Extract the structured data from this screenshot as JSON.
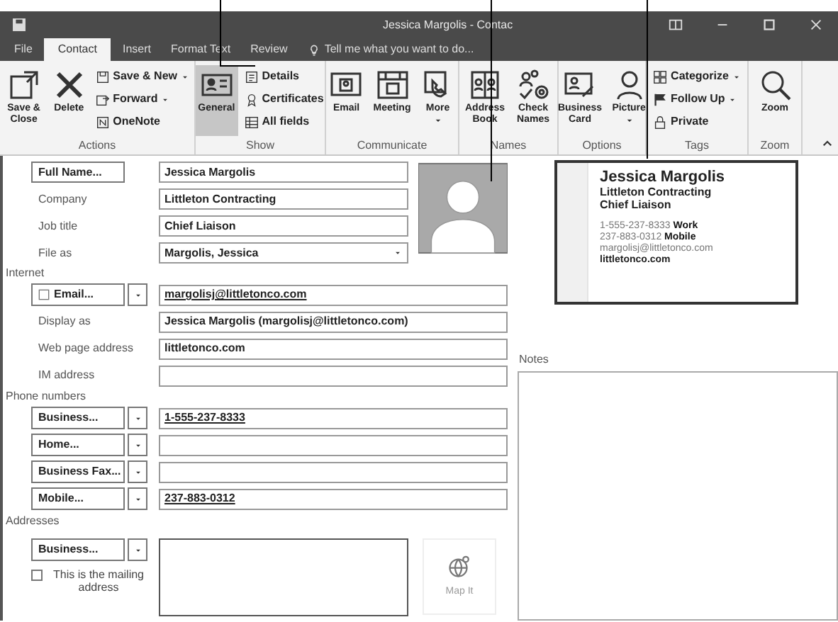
{
  "window": {
    "title": "Jessica Margolis - Contac"
  },
  "tabs": [
    {
      "label": "File",
      "selected": false
    },
    {
      "label": "Contact",
      "selected": true
    },
    {
      "label": "Insert",
      "selected": false
    },
    {
      "label": "Format Text",
      "selected": false
    },
    {
      "label": "Review",
      "selected": false
    }
  ],
  "tell_me": {
    "placeholder": "Tell me what you want to do..."
  },
  "ribbon_groups": [
    {
      "label": "Actions",
      "items": [
        {
          "label": "Save & Close",
          "kind": "large",
          "selected": false,
          "dropdown": false
        },
        {
          "label": "Delete",
          "kind": "large",
          "selected": false,
          "dropdown": false
        },
        {
          "label": "Save & New",
          "kind": "small",
          "selected": false,
          "dropdown": true
        },
        {
          "label": "Forward",
          "kind": "small",
          "selected": false,
          "dropdown": true
        },
        {
          "label": "OneNote",
          "kind": "small",
          "selected": false,
          "dropdown": false
        }
      ]
    },
    {
      "label": "Show",
      "items": [
        {
          "label": "General",
          "kind": "large",
          "selected": true,
          "dropdown": false
        },
        {
          "label": "Details",
          "kind": "small",
          "selected": false,
          "dropdown": false
        },
        {
          "label": "Certificates",
          "kind": "small",
          "selected": false,
          "dropdown": false
        },
        {
          "label": "All fields",
          "kind": "small",
          "selected": false,
          "dropdown": false
        }
      ]
    },
    {
      "label": "Communicate",
      "items": [
        {
          "label": "Email",
          "kind": "large",
          "selected": false,
          "dropdown": false
        },
        {
          "label": "Meeting",
          "kind": "large",
          "selected": false,
          "dropdown": false
        },
        {
          "label": "More",
          "kind": "large",
          "selected": false,
          "dropdown": true
        }
      ]
    },
    {
      "label": "Names",
      "items": [
        {
          "label": "Address Book",
          "kind": "large",
          "selected": false,
          "dropdown": false
        },
        {
          "label": "Check Names",
          "kind": "large",
          "selected": false,
          "dropdown": false
        }
      ]
    },
    {
      "label": "Options",
      "items": [
        {
          "label": "Business Card",
          "kind": "large",
          "selected": false,
          "dropdown": false
        },
        {
          "label": "Picture",
          "kind": "large",
          "selected": false,
          "dropdown": true
        }
      ]
    },
    {
      "label": "Tags",
      "items": [
        {
          "label": "Categorize",
          "kind": "small",
          "selected": false,
          "dropdown": true
        },
        {
          "label": "Follow Up",
          "kind": "small",
          "selected": false,
          "dropdown": true
        },
        {
          "label": "Private",
          "kind": "small",
          "selected": false,
          "dropdown": false
        }
      ]
    },
    {
      "label": "Zoom",
      "items": [
        {
          "label": "Zoom",
          "kind": "large",
          "selected": false,
          "dropdown": false
        }
      ]
    }
  ],
  "name_fields": [
    {
      "label": "Full Name...",
      "kind": "button",
      "value": "Jessica Margolis"
    },
    {
      "label": "Company",
      "kind": "label",
      "value": "Littleton Contracting"
    },
    {
      "label": "Job title",
      "kind": "label",
      "value": "Chief Liaison"
    },
    {
      "label": "File as",
      "kind": "dropdown",
      "value": "Margolis, Jessica"
    }
  ],
  "internet": {
    "heading": "Internet",
    "rows": [
      {
        "label": "Email...",
        "kind": "typed",
        "value": "margolisj@littletonco.com"
      },
      {
        "label": "Display as",
        "kind": "label",
        "value": "Jessica Margolis (margolisj@littletonco.com)"
      },
      {
        "label": "Web page address",
        "kind": "label",
        "value": "littletonco.com"
      },
      {
        "label": "IM address",
        "kind": "label"
      }
    ]
  },
  "phone": {
    "heading": "Phone numbers",
    "rows": [
      {
        "label": "Business...",
        "kind": "typed",
        "value": "1-555-237-8333"
      },
      {
        "label": "Home...",
        "kind": "typed"
      },
      {
        "label": "Business Fax...",
        "kind": "typed"
      },
      {
        "label": "Mobile...",
        "kind": "typed",
        "value": "237-883-0312"
      }
    ]
  },
  "addresses": {
    "heading": "Addresses",
    "type": "Business...",
    "mailing_checkbox": {
      "label": "This is the mailing address",
      "checked": false
    },
    "map_button": "Map It"
  },
  "business_card": {
    "name": "Jessica Margolis",
    "company": "Littleton Contracting",
    "title": "Chief Liaison",
    "lines": [
      "1-555-237-8333 **Work**",
      "237-883-0312 **Mobile**",
      "margolisj@littletonco.com"
    ],
    "web": "littletonco.com"
  },
  "notes": {
    "label": "Notes"
  }
}
